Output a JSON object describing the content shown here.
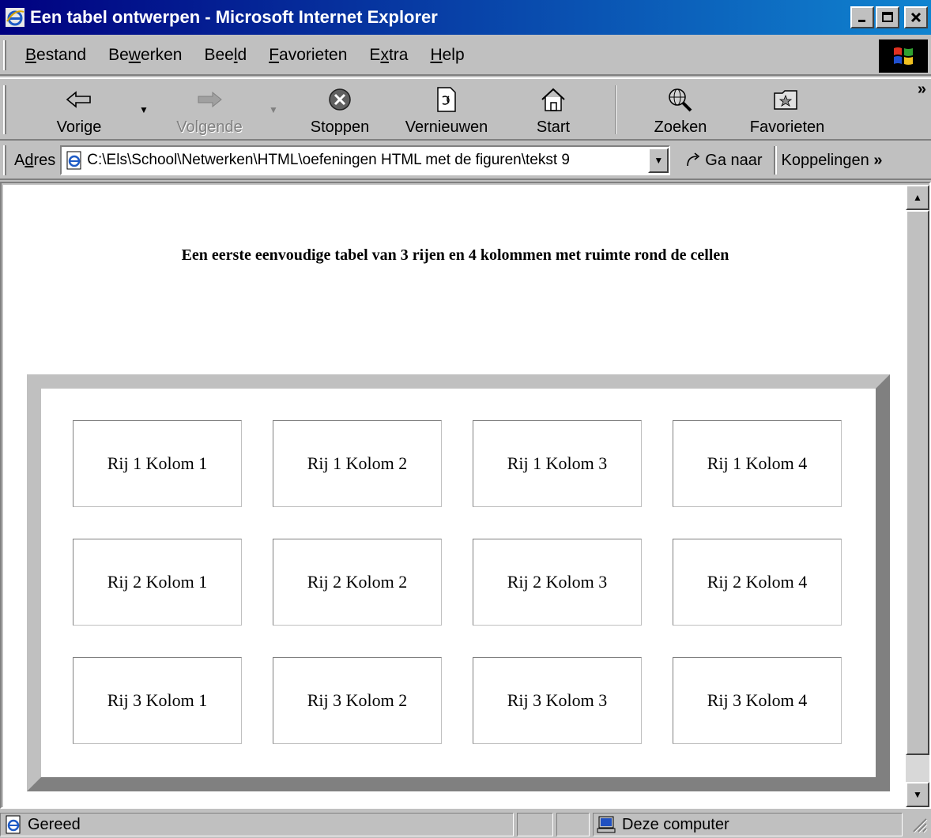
{
  "window": {
    "title": "Een tabel ontwerpen - Microsoft Internet Explorer",
    "minimize": "_",
    "maximize": "□",
    "close": "×"
  },
  "menu": [
    {
      "label": "Bestand",
      "accel": "B",
      "rest": "estand"
    },
    {
      "label": "Bewerken",
      "pre": "Be",
      "accel": "w",
      "rest": "erken"
    },
    {
      "label": "Beeld",
      "pre": "Bee",
      "accel": "l",
      "rest": "d"
    },
    {
      "label": "Favorieten",
      "accel": "F",
      "rest": "avorieten"
    },
    {
      "label": "Extra",
      "pre": "E",
      "accel": "x",
      "rest": "tra"
    },
    {
      "label": "Help",
      "accel": "H",
      "rest": "elp"
    }
  ],
  "toolbar": {
    "back": "Vorige",
    "forward": "Volgende",
    "stop": "Stoppen",
    "refresh": "Vernieuwen",
    "home": "Start",
    "search": "Zoeken",
    "favorites": "Favorieten",
    "more": "»"
  },
  "address": {
    "label": "Adres",
    "label_accel": "d",
    "value": "C:\\Els\\School\\Netwerken\\HTML\\oefeningen HTML met de figuren\\tekst 9",
    "go": "Ga naar",
    "links": "Koppelingen",
    "more": "»"
  },
  "page": {
    "heading": "Een eerste eenvoudige tabel van 3 rijen en 4 kolommen met ruimte rond de cellen",
    "table": [
      [
        "Rij 1 Kolom 1",
        "Rij 1 Kolom 2",
        "Rij 1 Kolom 3",
        "Rij 1 Kolom 4"
      ],
      [
        "Rij 2 Kolom 1",
        "Rij 2 Kolom 2",
        "Rij 2 Kolom 3",
        "Rij 2 Kolom 4"
      ],
      [
        "Rij 3 Kolom 1",
        "Rij 3 Kolom 2",
        "Rij 3 Kolom 3",
        "Rij 3 Kolom 4"
      ]
    ]
  },
  "status": {
    "text": "Gereed",
    "zone": "Deze computer"
  }
}
